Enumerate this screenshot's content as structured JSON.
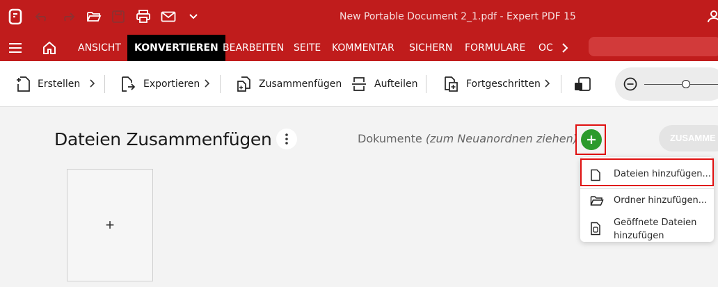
{
  "window": {
    "title": "New Portable Document 2_1.pdf   -   Expert PDF 15"
  },
  "quick_access": {
    "icons": [
      "app-logo-icon",
      "undo-icon",
      "redo-icon",
      "open-folder-icon",
      "save-icon",
      "print-icon",
      "email-icon",
      "customize-chevron-icon"
    ]
  },
  "menu": {
    "items": [
      {
        "label": "ANSICHT"
      },
      {
        "label": "KONVERTIEREN",
        "active": true
      },
      {
        "label": "BEARBEITEN"
      },
      {
        "label": "SEITE"
      },
      {
        "label": "KOMMENTAR"
      },
      {
        "label": "SICHERN"
      },
      {
        "label": "FORMULARE"
      },
      {
        "label": "OC"
      }
    ]
  },
  "ribbon": {
    "create": "Erstellen",
    "export": "Exportieren",
    "merge": "Zusammenfügen",
    "split": "Aufteilen",
    "advanced": "Fortgeschritten"
  },
  "main": {
    "title": "Dateien Zusammenfügen",
    "documents_label": "Dokumente",
    "documents_hint": "(zum Neuanordnen ziehen)",
    "merge_button": "ZUSAMME",
    "dropzone_plus": "+"
  },
  "dropdown": {
    "items": [
      {
        "label": "Dateien hinzufügen..."
      },
      {
        "label": "Ordner hinzufügen..."
      },
      {
        "label_line1": "Geöffnete Dateien",
        "label_line2": "hinzufügen"
      }
    ]
  },
  "colors": {
    "brand_red": "#c01c1c",
    "active_tab": "#000000",
    "add_green": "#2c9a2c",
    "highlight_red": "#e01010"
  }
}
